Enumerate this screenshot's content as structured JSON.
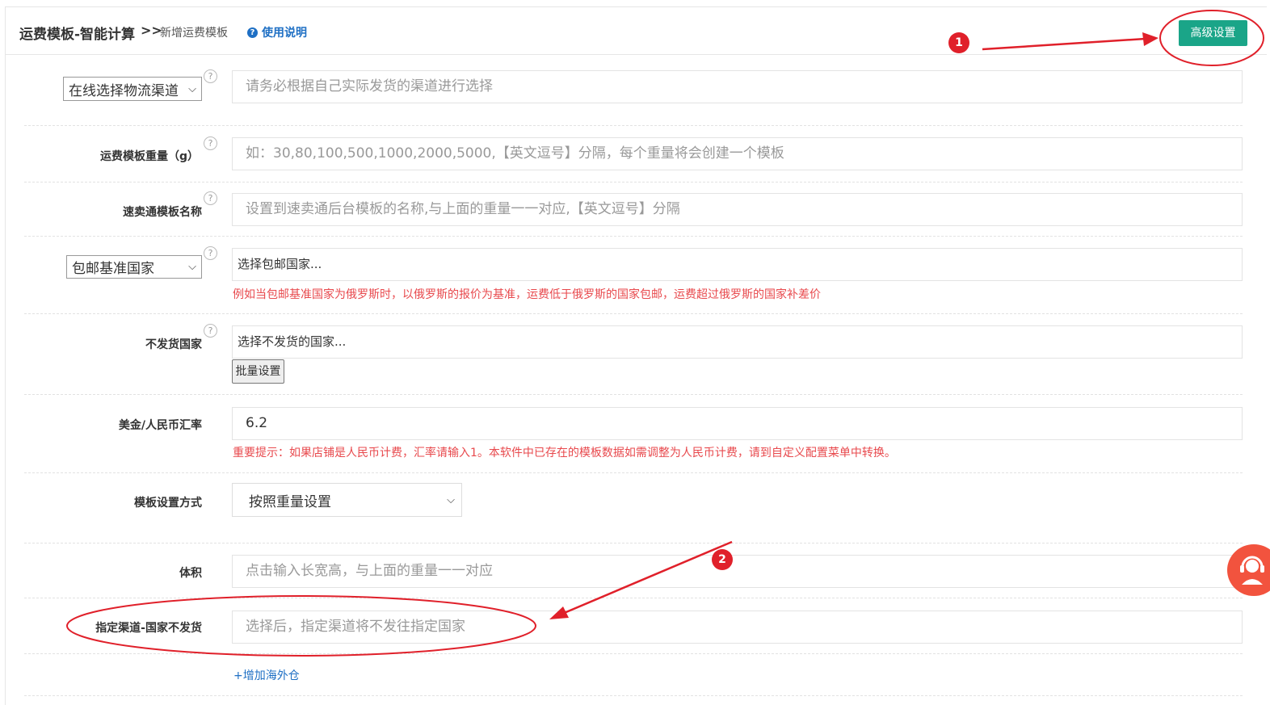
{
  "header": {
    "title": "运费模板-智能计算",
    "arrows": ">>",
    "subtitle": "新增运费模板",
    "help_label": "使用说明",
    "help_icon_glyph": "?",
    "advanced_button": "高级设置"
  },
  "form": {
    "channel": {
      "select_value": "在线选择物流渠道",
      "placeholder": "请务必根据自己实际发货的渠道进行选择"
    },
    "weight": {
      "label": "运费模板重量（g）",
      "placeholder": "如：30,80,100,500,1000,2000,5000,【英文逗号】分隔，每个重量将会创建一个模板"
    },
    "template_name": {
      "label": "速卖通模板名称",
      "placeholder": "设置到速卖通后台模板的名称,与上面的重量一一对应,【英文逗号】分隔"
    },
    "free_shipping": {
      "select_value": "包邮基准国家",
      "placeholder": "选择包邮国家...",
      "tip": "例如当包邮基准国家为俄罗斯时，以俄罗斯的报价为基准，运费低于俄罗斯的国家包邮，运费超过俄罗斯的国家补差价"
    },
    "no_ship": {
      "label": "不发货国家",
      "placeholder": "选择不发货的国家...",
      "batch_button": "批量设置"
    },
    "rate": {
      "label": "美金/人民币汇率",
      "value": "6.2",
      "tip": "重要提示：如果店铺是人民币计费，汇率请输入1。本软件中已存在的模板数据如需调整为人民币计费，请到自定义配置菜单中转换。"
    },
    "mode": {
      "label": "模板设置方式",
      "value": "按照重量设置"
    },
    "volume": {
      "label": "体积",
      "placeholder": "点击输入长宽高，与上面的重量一一对应"
    },
    "channel_no_ship": {
      "label": "指定渠道-国家不发货",
      "placeholder": "选择后，指定渠道将不发往指定国家"
    },
    "add_overseas": "+增加海外仓"
  },
  "help_glyph": "?",
  "annotations": {
    "badge_1": "1",
    "badge_2": "2",
    "color": "#e0202a"
  },
  "colors": {
    "accent_green": "#1aa588",
    "link_blue": "#1e6fc4",
    "tip_red": "#e8494d",
    "support_orange": "#f2533e"
  }
}
